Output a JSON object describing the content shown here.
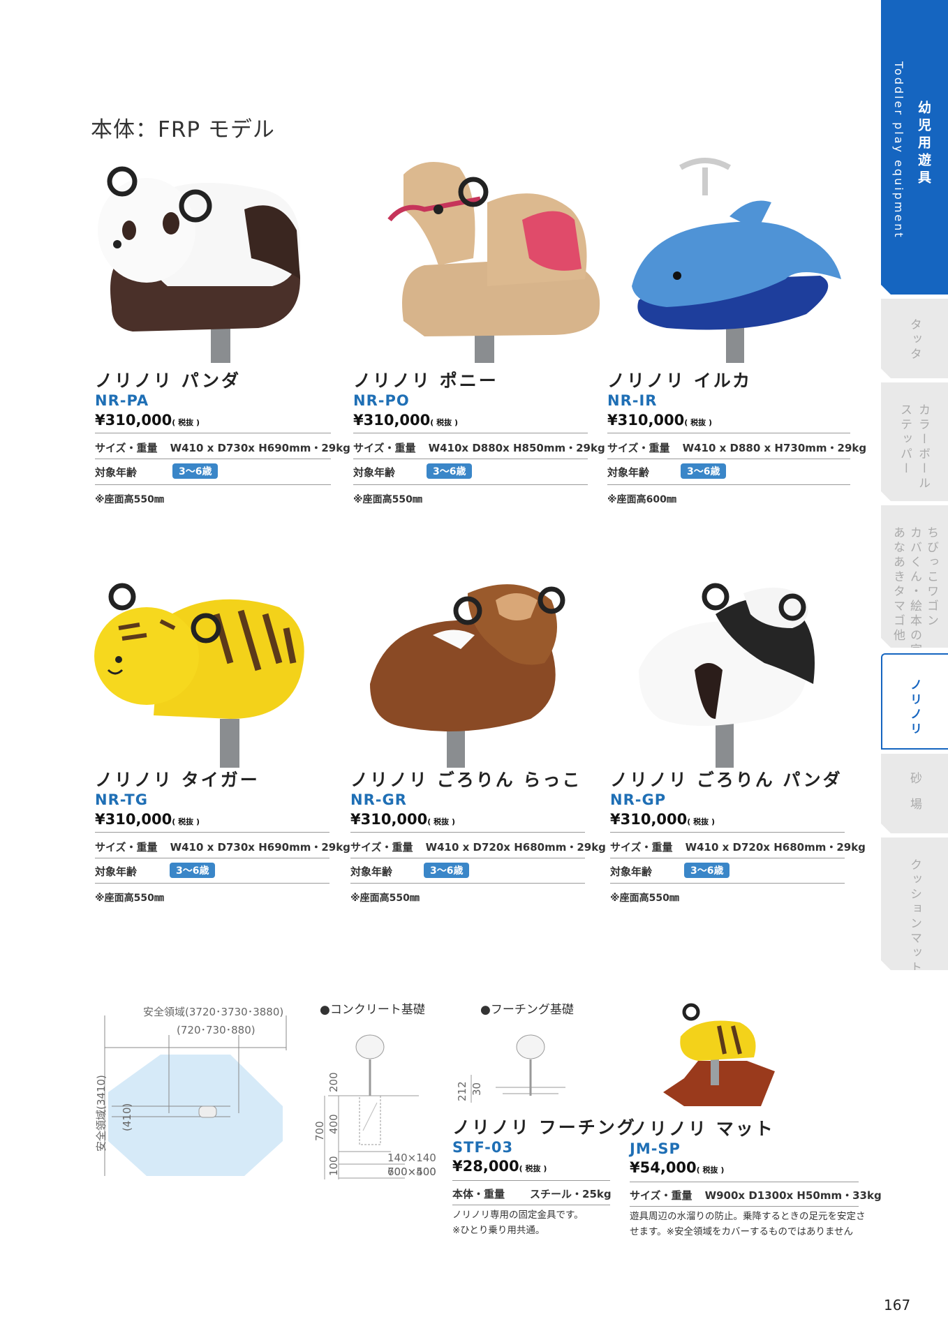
{
  "section_title": "本体：FRP モデル",
  "side_tabs": [
    {
      "label": "幼児用遊具",
      "sub": "Toddler play equipment"
    },
    {
      "label": "タッタ"
    },
    {
      "label1": "カラーボール",
      "label2": "ステッパー"
    },
    {
      "label1": "ちびっこワゴン",
      "label2": "カバくん・絵本の家",
      "label3": "あなあきタマゴ他"
    },
    {
      "label": "ノリノリ"
    },
    {
      "label": "砂場"
    },
    {
      "label": "クッションマット"
    }
  ],
  "spec_label_size": "サイズ・重量",
  "spec_label_age": "対象年齢",
  "tax_note": "( 税抜 )",
  "products": [
    {
      "name": "ノリノリ パンダ",
      "code": "NR-PA",
      "price": "¥310,000",
      "size": "W410 x D730x H690mm・29kg",
      "age": "3～6歳",
      "note": "※座面高550㎜"
    },
    {
      "name": "ノリノリ ポニー",
      "code": "NR-PO",
      "price": "¥310,000",
      "size": "W410x D880x H850mm・29kg",
      "age": "3～6歳",
      "note": "※座面高550㎜"
    },
    {
      "name": "ノリノリ イルカ",
      "code": "NR-IR",
      "price": "¥310,000",
      "size": "W410 x D880 x H730mm・29kg",
      "age": "3～6歳",
      "note": "※座面高600㎜"
    },
    {
      "name": "ノリノリ タイガー",
      "code": "NR-TG",
      "price": "¥310,000",
      "size": "W410 x D730x H690mm・29kg",
      "age": "3～6歳",
      "note": "※座面高550㎜"
    },
    {
      "name": "ノリノリ ごろりん らっこ",
      "code": "NR-GR",
      "price": "¥310,000",
      "size": "W410 x D720x H680mm・29kg",
      "age": "3～6歳",
      "note": "※座面高550㎜"
    },
    {
      "name": "ノリノリ ごろりん パンダ",
      "code": "NR-GP",
      "price": "¥310,000",
      "size": "W410 x D720x H680mm・29kg",
      "age": "3～6歳",
      "note": "※座面高550㎜"
    }
  ],
  "safety_diagram": {
    "outer_label": "安全領域(3720･3730･3880)",
    "inner_label": "(720･730･880)",
    "side_label": "安全領域(3410)",
    "side_inner": "(410)"
  },
  "foundation": {
    "concrete_title": "●コンクリート基礎",
    "footing_title": "●フーチング基礎",
    "dims_vertical": [
      "200",
      "400",
      "700",
      "100"
    ],
    "dims_boxes": [
      "140×140",
      "600×400",
      "700×500"
    ],
    "footing_dims": [
      "212",
      "30"
    ]
  },
  "accessories": [
    {
      "name": "ノリノリ フーチング",
      "code": "STF-03",
      "price": "¥28,000",
      "spec_label": "本体・重量",
      "spec": "スチール・25kg",
      "desc1": "ノリノリ専用の固定金具です。",
      "desc2": "※ひとり乗り用共通。"
    },
    {
      "name": "ノリノリ マット",
      "code": "JM-SP",
      "price": "¥54,000",
      "spec_label": "サイズ・重量",
      "spec": "W900x D1300x H50mm・33kg",
      "desc1": "遊具周辺の水溜りの防止。乗降するときの足元を安定さ",
      "desc2": "せます。※安全領域をカバーするものではありません"
    }
  ],
  "page_number": "167",
  "colors": {
    "accent_blue": "#1565c0",
    "code_blue": "#1f6fb5",
    "age_badge": "#3a86c8"
  }
}
